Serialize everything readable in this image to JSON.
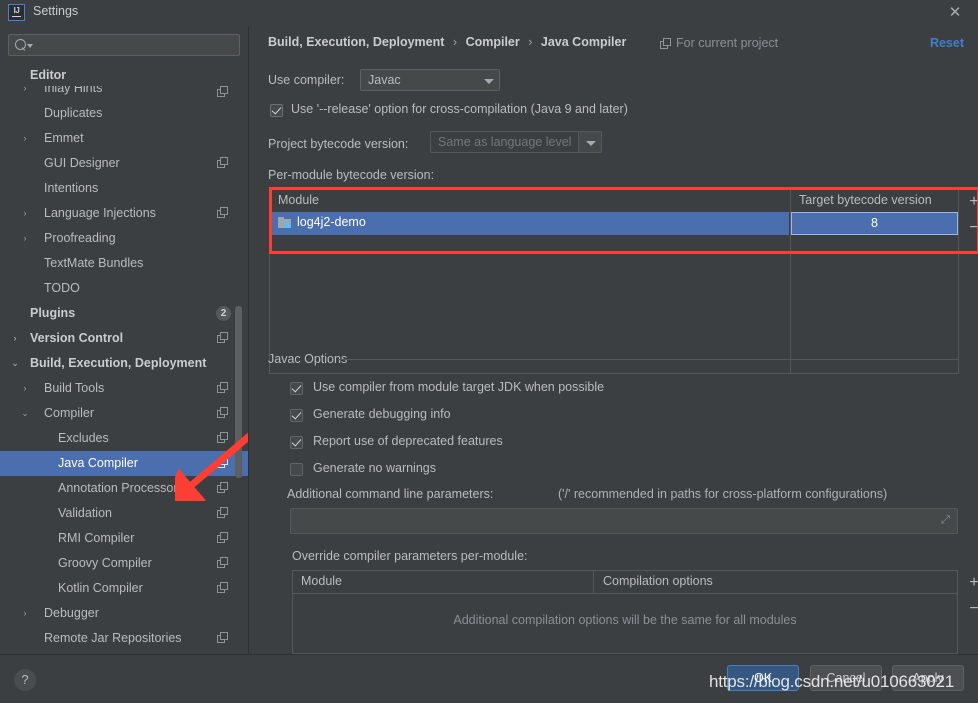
{
  "window": {
    "title": "Settings",
    "logo_text": "IJ",
    "close_icon": "✕"
  },
  "sidebar": {
    "search": {
      "placeholder": "",
      "value": "",
      "icon": "search-icon"
    },
    "items": [
      {
        "label": "Editor",
        "level": 0,
        "bold": true,
        "arrow": "",
        "cfg": false,
        "badge": ""
      },
      {
        "label": "Inlay Hints",
        "level": 1,
        "bold": false,
        "arrow": "›",
        "cfg": true,
        "badge": ""
      },
      {
        "label": "Duplicates",
        "level": 1,
        "bold": false,
        "arrow": "",
        "cfg": false,
        "badge": ""
      },
      {
        "label": "Emmet",
        "level": 1,
        "bold": false,
        "arrow": "›",
        "cfg": false,
        "badge": ""
      },
      {
        "label": "GUI Designer",
        "level": 1,
        "bold": false,
        "arrow": "",
        "cfg": true,
        "badge": ""
      },
      {
        "label": "Intentions",
        "level": 1,
        "bold": false,
        "arrow": "",
        "cfg": false,
        "badge": ""
      },
      {
        "label": "Language Injections",
        "level": 1,
        "bold": false,
        "arrow": "›",
        "cfg": true,
        "badge": ""
      },
      {
        "label": "Proofreading",
        "level": 1,
        "bold": false,
        "arrow": "›",
        "cfg": false,
        "badge": ""
      },
      {
        "label": "TextMate Bundles",
        "level": 1,
        "bold": false,
        "arrow": "",
        "cfg": false,
        "badge": ""
      },
      {
        "label": "TODO",
        "level": 1,
        "bold": false,
        "arrow": "",
        "cfg": false,
        "badge": ""
      },
      {
        "label": "Plugins",
        "level": 0,
        "bold": true,
        "arrow": "",
        "cfg": false,
        "badge": "2"
      },
      {
        "label": "Version Control",
        "level": 0,
        "bold": true,
        "arrow": "›",
        "cfg": true,
        "badge": ""
      },
      {
        "label": "Build, Execution, Deployment",
        "level": 0,
        "bold": true,
        "arrow": "⌄",
        "cfg": false,
        "badge": ""
      },
      {
        "label": "Build Tools",
        "level": 1,
        "bold": false,
        "arrow": "›",
        "cfg": true,
        "badge": ""
      },
      {
        "label": "Compiler",
        "level": 1,
        "bold": false,
        "arrow": "⌄",
        "cfg": true,
        "badge": ""
      },
      {
        "label": "Excludes",
        "level": 2,
        "bold": false,
        "arrow": "",
        "cfg": true,
        "badge": ""
      },
      {
        "label": "Java Compiler",
        "level": 2,
        "bold": false,
        "arrow": "",
        "cfg": true,
        "badge": "",
        "selected": true
      },
      {
        "label": "Annotation Processors",
        "level": 2,
        "bold": false,
        "arrow": "",
        "cfg": true,
        "badge": ""
      },
      {
        "label": "Validation",
        "level": 2,
        "bold": false,
        "arrow": "",
        "cfg": true,
        "badge": ""
      },
      {
        "label": "RMI Compiler",
        "level": 2,
        "bold": false,
        "arrow": "",
        "cfg": true,
        "badge": ""
      },
      {
        "label": "Groovy Compiler",
        "level": 2,
        "bold": false,
        "arrow": "",
        "cfg": true,
        "badge": ""
      },
      {
        "label": "Kotlin Compiler",
        "level": 2,
        "bold": false,
        "arrow": "",
        "cfg": true,
        "badge": ""
      },
      {
        "label": "Debugger",
        "level": 1,
        "bold": false,
        "arrow": "›",
        "cfg": false,
        "badge": ""
      },
      {
        "label": "Remote Jar Repositories",
        "level": 1,
        "bold": false,
        "arrow": "",
        "cfg": true,
        "badge": ""
      }
    ]
  },
  "header": {
    "breadcrumb": [
      "Build, Execution, Deployment",
      "Compiler",
      "Java Compiler"
    ],
    "separator": "›",
    "scope_label": "For current project",
    "scope_icon": "copy-icon",
    "reset_label": "Reset"
  },
  "main": {
    "use_compiler_label": "Use compiler:",
    "use_compiler_value": "Javac",
    "release_option_label": "Use '--release' option for cross-compilation (Java 9 and later)",
    "release_option_checked": true,
    "project_bytecode_label": "Project bytecode version:",
    "project_bytecode_value": "Same as language level",
    "per_module_label": "Per-module bytecode version:",
    "module_table": {
      "columns": [
        "Module",
        "Target bytecode version"
      ],
      "rows": [
        {
          "module": "log4j2-demo",
          "target": "8"
        }
      ],
      "add_label": "+",
      "remove_label": "−"
    },
    "javac_options": {
      "group_label": "Javac Options",
      "checkboxes": [
        {
          "label": "Use compiler from module target JDK when possible",
          "checked": true
        },
        {
          "label": "Generate debugging info",
          "checked": true
        },
        {
          "label": "Report use of deprecated features",
          "checked": true
        },
        {
          "label": "Generate no warnings",
          "checked": false
        }
      ],
      "additional_params_label": "Additional command line parameters:",
      "additional_params_hint": "('/' recommended in paths for cross-platform configurations)",
      "additional_params_value": "",
      "expand_icon": "expand-icon"
    },
    "override_section": {
      "label": "Override compiler parameters per-module:",
      "columns": [
        "Module",
        "Compilation options"
      ],
      "empty_text": "Additional compilation options will be the same for all modules",
      "add_label": "+",
      "remove_label": "−"
    }
  },
  "footer": {
    "help_label": "?",
    "buttons": [
      {
        "label": "OK",
        "primary": true
      },
      {
        "label": "Cancel",
        "primary": false
      },
      {
        "label": "Apply",
        "primary": false
      }
    ]
  },
  "overlay": {
    "watermark": "https://blog.csdn.net/u010663021"
  },
  "colors": {
    "background": "#3c3f41",
    "selection": "#4b6eaf",
    "accent_link": "#3f7fd0",
    "annotation_red": "#fc3f32",
    "primary_button": "#365880"
  }
}
